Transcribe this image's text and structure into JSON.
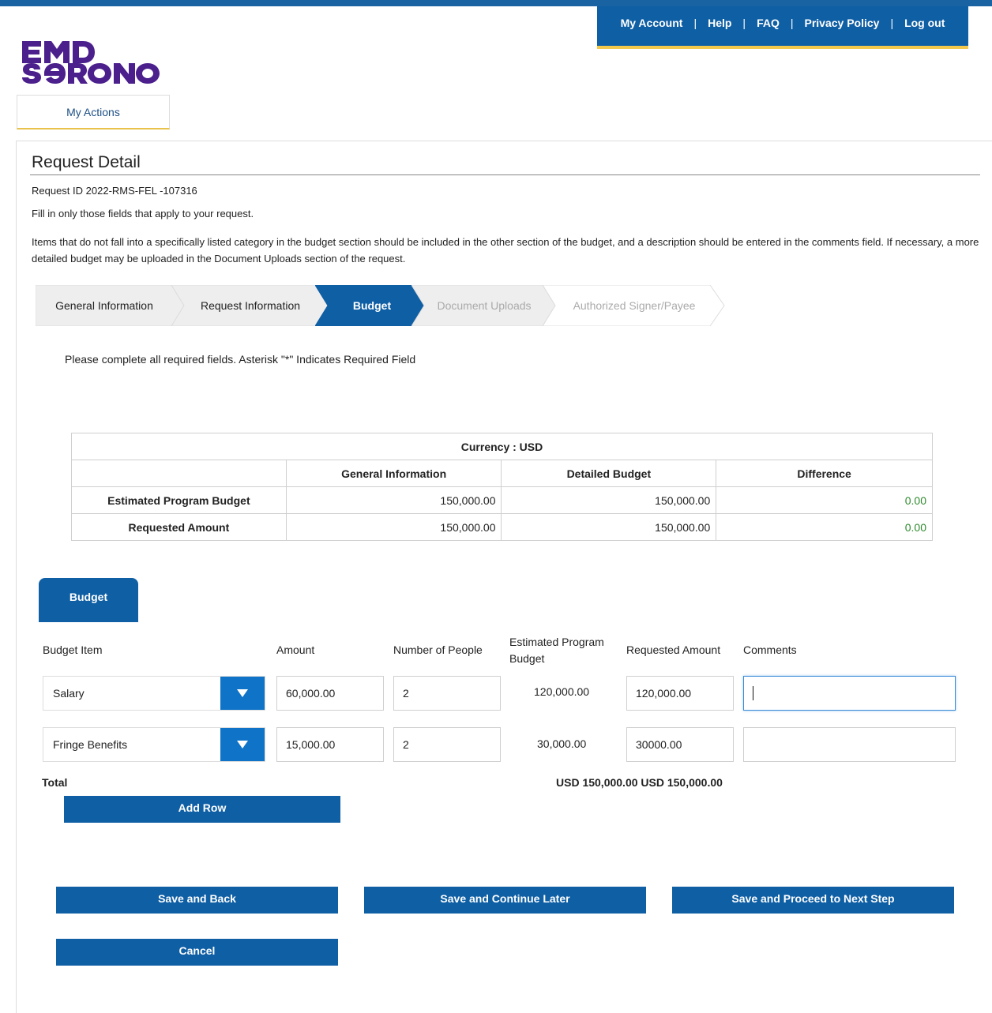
{
  "header": {
    "nav": [
      "My Account",
      "Help",
      "FAQ",
      "Privacy Policy",
      "Log out"
    ],
    "separator": "|",
    "logo_text": "EMD SERONO",
    "my_actions": "My Actions"
  },
  "page": {
    "title": "Request Detail",
    "request_id": "Request ID 2022-RMS-FEL -107316",
    "fill_note": "Fill in only those fields that apply to your request.",
    "items_note": "Items that do not fall into a specifically listed category in the budget section should be included in the other section of the budget, and a description should be entered in the comments field. If necessary, a more detailed budget may be uploaded in the Document Uploads section of the request.",
    "required_note": "Please complete all required fields. Asterisk \"*\" Indicates Required Field"
  },
  "steps": [
    {
      "label": "General Information",
      "state": "done"
    },
    {
      "label": "Request Information",
      "state": "done"
    },
    {
      "label": "Budget",
      "state": "active"
    },
    {
      "label": "Document Uploads",
      "state": "pending"
    },
    {
      "label": "Authorized Signer/Payee",
      "state": "pending"
    }
  ],
  "summary": {
    "currency": "Currency : USD",
    "headers": [
      "General Information",
      "Detailed Budget",
      "Difference"
    ],
    "rows": [
      {
        "label": "Estimated Program Budget",
        "general": "150,000.00",
        "detailed": "150,000.00",
        "difference": "0.00"
      },
      {
        "label": "Requested Amount",
        "general": "150,000.00",
        "detailed": "150,000.00",
        "difference": "0.00"
      }
    ]
  },
  "budget": {
    "tab_label": "Budget",
    "columns": {
      "item": "Budget Item",
      "amount": "Amount",
      "people": "Number of People",
      "estimated": "Estimated Program Budget",
      "requested": "Requested Amount",
      "comments": "Comments"
    },
    "rows": [
      {
        "item": "Salary",
        "amount": "60,000.00",
        "people": "2",
        "estimated": "120,000.00",
        "requested": "120,000.00",
        "comments": ""
      },
      {
        "item": "Fringe Benefits",
        "amount": "15,000.00",
        "people": "2",
        "estimated": "30,000.00",
        "requested": "30000.00",
        "comments": ""
      }
    ],
    "total_label": "Total",
    "total_values": "USD 150,000.00 USD 150,000.00",
    "add_row": "Add Row"
  },
  "actions": {
    "save_back": "Save and Back",
    "save_later": "Save and Continue Later",
    "save_next": "Save and Proceed to Next Step",
    "cancel": "Cancel"
  },
  "colors": {
    "primary": "#0f5fa5",
    "accent": "#f2c94c",
    "difference": "#2e8b2e"
  }
}
